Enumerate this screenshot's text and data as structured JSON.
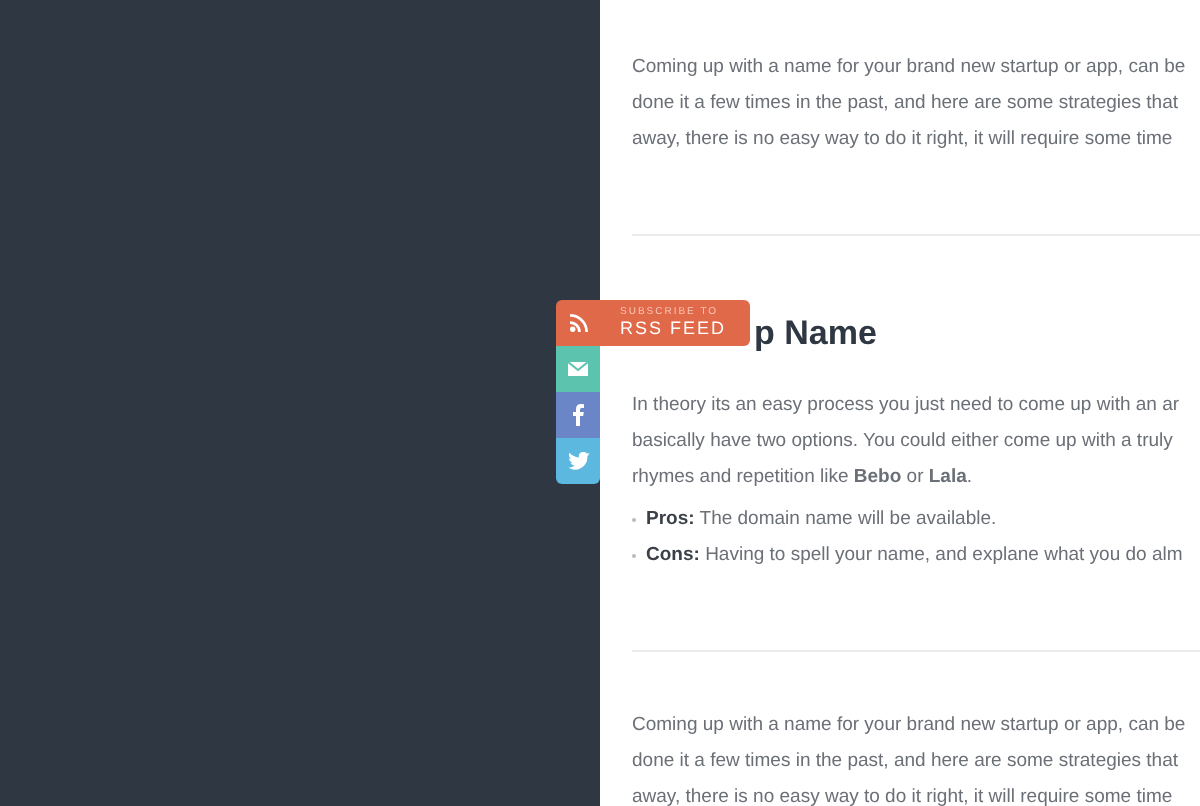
{
  "intro_paragraph": {
    "lines": [
      "Coming up with a name for your brand new startup or app, can be",
      "done it a few times in the past, and here are some strategies that",
      "away, there is no easy way to do it right, it will require some time"
    ]
  },
  "section": {
    "heading": "p Name",
    "lines": [
      "In theory its an easy process you just need to come up with an ar",
      "basically have two options. You could either come up with a truly",
      "rhymes and repetition like **Bebo** or **Lala**."
    ],
    "bullets": [
      {
        "term": "Pros:",
        "text": "The domain name will be available."
      },
      {
        "term": "Cons:",
        "text": "Having to spell your name, and explane what you do alm"
      }
    ]
  },
  "outro_paragraph": {
    "lines": [
      "Coming up with a name for your brand new startup or app, can be",
      "done it a few times in the past, and here are some strategies that",
      "away, there is no easy way to do it right, it will require some time"
    ]
  },
  "share_bar": {
    "caption": "SUBSCRIBE TO",
    "label": "RSS FEED",
    "buttons": [
      {
        "kind": "rss"
      },
      {
        "kind": "email"
      },
      {
        "kind": "facebook"
      },
      {
        "kind": "twitter"
      }
    ]
  }
}
